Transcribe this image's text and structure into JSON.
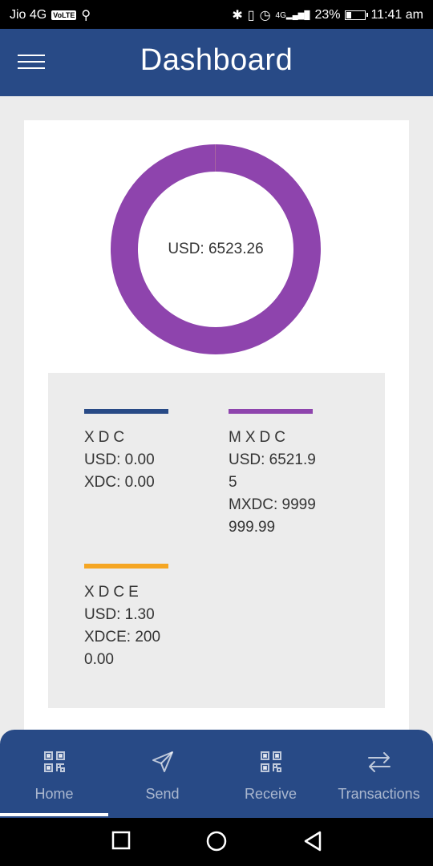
{
  "status_bar": {
    "carrier": "Jio 4G",
    "volte": "VoLTE",
    "battery": "23%",
    "time": "11:41 am",
    "network": "4G"
  },
  "header": {
    "title": "Dashboard"
  },
  "portfolio": {
    "total_label": "USD: 6523.26",
    "chart_data": {
      "type": "pie",
      "categories": [
        "XDC",
        "MXDC",
        "XDCE"
      ],
      "values": [
        0.0,
        6521.95,
        1.3
      ],
      "colors": [
        "#284a86",
        "#8e44ad",
        "#f5a623"
      ]
    }
  },
  "assets": [
    {
      "name": "XDC",
      "color": "#284a86",
      "usd_line": "USD: 0.00",
      "amount_line": "XDC: 0.00"
    },
    {
      "name": "MXDC",
      "color": "#8e44ad",
      "usd_line": "USD: 6521.95",
      "amount_line": "MXDC: 9999999.99"
    },
    {
      "name": "XDCE",
      "color": "#f5a623",
      "usd_line": "USD: 1.30",
      "amount_line": "XDCE: 2000.00"
    }
  ],
  "nav": {
    "items": [
      {
        "label": "Home",
        "icon": "qr-code-icon"
      },
      {
        "label": "Send",
        "icon": "send-icon"
      },
      {
        "label": "Receive",
        "icon": "qr-code-icon"
      },
      {
        "label": "Transactions",
        "icon": "swap-icon"
      }
    ],
    "active": "Home"
  }
}
